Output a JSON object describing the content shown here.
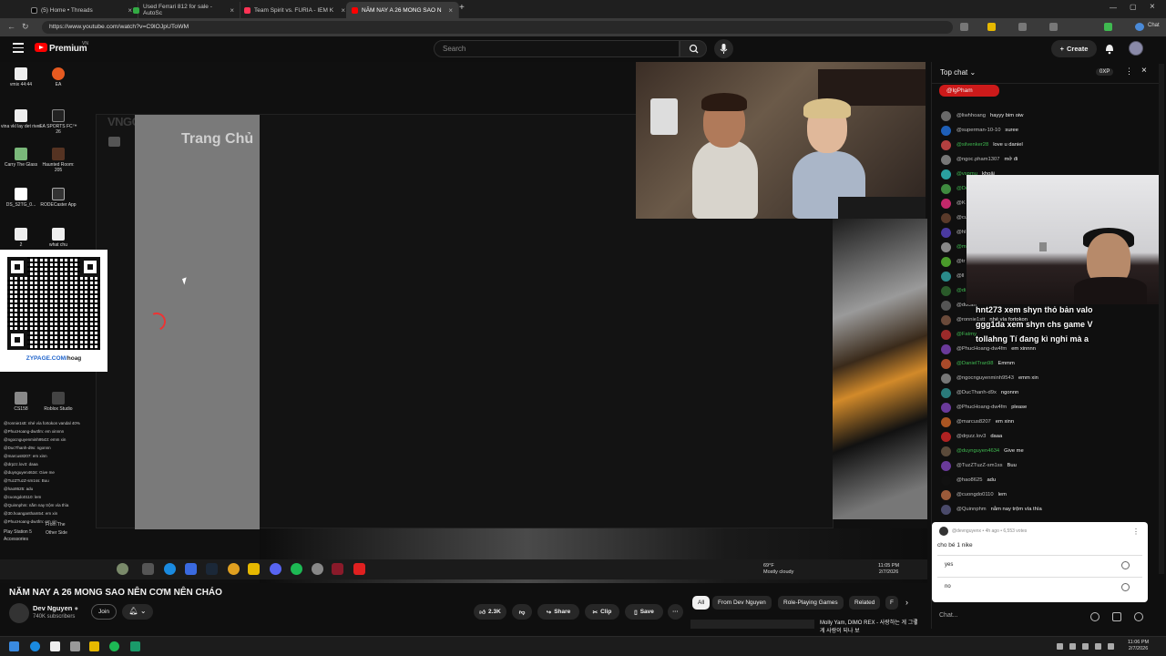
{
  "browser": {
    "tabs": [
      {
        "label": "(5) Home • Threads",
        "color": "#000000"
      },
      {
        "label": "Used Ferrari 812 for sale - AutoSc",
        "color": "#33aa44"
      },
      {
        "label": "Team Spirit vs. FURIA - IEM K",
        "color": "#ff3355"
      },
      {
        "label": "NĂM NAY A 26 MONG SAO N",
        "color": "#ff0000"
      }
    ],
    "url": "https://www.youtube.com/watch?v=C9lOJpUToWM"
  },
  "header": {
    "brand": "Premium",
    "region": "VN",
    "search_placeholder": "Search",
    "create_label": "Create"
  },
  "stream": {
    "desktop_icons": [
      "vmix 44:44",
      "EA",
      "vina vkl lay det river",
      "EA SPORTS FC™ 26",
      "Carry The Glass",
      "Haunted Room: 205",
      "DS_S2TG_0...",
      "RODECaster App",
      "2",
      "what chu",
      "CS158",
      "Roblox Studio",
      "Play Station 5",
      "From The Other Side",
      "Accessories"
    ],
    "launcher_brand": "VNGGAMES",
    "launcher_heading": "Trang Chủ",
    "qr_url_prefix": "ZYPAGE.COM/",
    "qr_url_suffix": "hoag",
    "weather_temp": "69°F",
    "weather_desc": "Mostly cloudy",
    "time": "11:05 PM",
    "date": "2/7/2026",
    "mini_chat": [
      "@ronnie1stt: nhé vía fortokon vandal 40%",
      "@PhucHoang-dw4fm: em xinnnn",
      "@ngocnguyenminh9543: emm xin",
      "@DucThanh-d9x: ngonnn",
      "@marcus8207: em xinn",
      "@drpzz.lov3: daaa",
      "@duynguyen4634: Give me",
      "@TuzZTuzZ-sm1ss: Buu",
      "@hao8625: adu",
      "@cuongdo0110: lem",
      "@Quinnphm: nằm nay trộm vía thìa",
      "@30.hoangantham54: em xin",
      "@PhucHoang-dw4fm: em xin"
    ]
  },
  "chat": {
    "mode_label": "Top chat",
    "xp_badge": "0XP",
    "pinned_user": "@lgPham",
    "messages": [
      {
        "user": "@liwhhoang",
        "text": "hayyy bim oiw",
        "color": "#6a6a6a",
        "green": false
      },
      {
        "user": "@superman-10-10",
        "text": "suree",
        "color": "#1e5fb8",
        "green": false
      },
      {
        "user": "@silvenker28",
        "text": "love u daniel",
        "color": "#b34040",
        "green": true
      },
      {
        "user": "@ngoc.pham1307",
        "text": "mở đi",
        "color": "#777777",
        "green": false
      },
      {
        "user": "@vspmu",
        "text": "khoải",
        "color": "#2aa0a0",
        "green": true
      },
      {
        "user": "@De",
        "text": "",
        "color": "#3f8a3f",
        "green": true
      },
      {
        "user": "@K",
        "text": "",
        "color": "#c2286a",
        "green": false
      },
      {
        "user": "@cu",
        "text": "",
        "color": "#5a3a2a",
        "green": false
      },
      {
        "user": "@hl",
        "text": "",
        "color": "#4a3aa0",
        "green": false
      },
      {
        "user": "@m",
        "text": "",
        "color": "#888888",
        "green": true
      },
      {
        "user": "@tr",
        "text": "",
        "color": "#4a9a2a",
        "green": false
      },
      {
        "user": "@ll",
        "text": "",
        "color": "#2a8a8a",
        "green": false
      },
      {
        "user": "@di",
        "text": "",
        "color": "#2a5a2a",
        "green": true
      },
      {
        "user": "@ducan",
        "text": "",
        "color": "#555555",
        "green": false
      },
      {
        "user": "@ronnie1stt",
        "text": "nhé vía fortokon",
        "color": "#6a4a3a",
        "green": false
      },
      {
        "user": "@Fatmy",
        "text": "",
        "color": "#9a2a2a",
        "green": true
      },
      {
        "user": "@PhucHoang-dw4fm",
        "text": "em xinnnn",
        "color": "#6a3a9a",
        "green": false
      },
      {
        "user": "@DanielTran98",
        "text": "Emmm",
        "color": "#aa4a2a",
        "green": true
      },
      {
        "user": "@ngocnguyenminh9543",
        "text": "emm xin",
        "color": "#777777",
        "green": false
      },
      {
        "user": "@DucThanh-d9x",
        "text": "ngonnn",
        "color": "#2a7a7a",
        "green": false
      },
      {
        "user": "@PhucHoang-dw4fm",
        "text": "please",
        "color": "#6a3a9a",
        "green": false
      },
      {
        "user": "@marcus8207",
        "text": "em xinn",
        "color": "#aa5522",
        "green": false
      },
      {
        "user": "@drpzz.lov3",
        "text": "daaa",
        "color": "#b02222",
        "green": false
      },
      {
        "user": "@duynguyen4634",
        "text": "Give me",
        "color": "#5a4a3a",
        "green": true
      },
      {
        "user": "@TuzZTuzZ-sm1ss",
        "text": "Buu",
        "color": "#6a3a9a",
        "green": false
      },
      {
        "user": "@hao8625",
        "text": "adu",
        "color": "#111111",
        "green": false
      },
      {
        "user": "@cuongdo0110",
        "text": "lem",
        "color": "#9a5a3a",
        "green": false
      },
      {
        "user": "@Quinnphm",
        "text": "nằm nay trộm vía thìa",
        "color": "#4a4a6a",
        "green": false
      }
    ],
    "overlay_lines": [
      "hnt273 xem shyn thỏ bản valo",
      "ggg1da xem shyn chs game V",
      "tollahng Tí đang kì nghỉ mà a"
    ],
    "poll": {
      "meta": "@devnguyenx • 4h ago • 6,553 votes",
      "question": "cho bé 1 nike",
      "options": [
        "yes",
        "no"
      ]
    },
    "input_placeholder": "Chat..."
  },
  "video": {
    "title": "NĂM NAY A 26 MONG SAO NÊN CƠM NÊN CHÁO",
    "channel": "Dev Nguyen",
    "subscribers": "740K subscribers",
    "join_label": "Join",
    "likes": "2.3K",
    "share_label": "Share",
    "clip_label": "Clip",
    "save_label": "Save"
  },
  "related_chips": [
    "All",
    "From Dev Nguyen",
    "Role-Playing Games",
    "Related",
    "F"
  ],
  "recommendation": "Molly Yam, DIMO REX - 사랑하는 게 그렇게 사랑이 되나 보",
  "taskbar": {
    "time": "11:06 PM",
    "date": "2/7/2026"
  }
}
